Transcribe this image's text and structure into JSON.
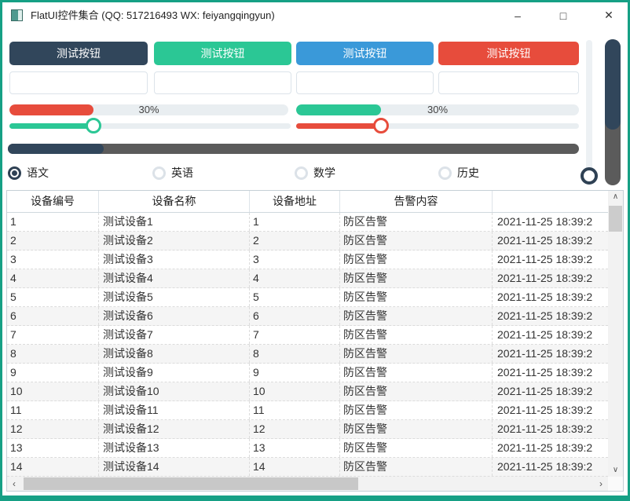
{
  "window": {
    "title": "FlatUI控件集合 (QQ: 517216493 WX: feiyangqingyun)",
    "minimize_glyph": "–",
    "maximize_glyph": "□",
    "close_glyph": "✕"
  },
  "colors": {
    "window_border": "#16A085",
    "dark": "#31465B",
    "green": "#2BC795",
    "blue": "#3A99D9",
    "red": "#E74C3C",
    "light_track": "#E9EEF1",
    "dark_track": "#5B5B5B"
  },
  "buttons": [
    {
      "label": "测试按钮",
      "color": "#31465B"
    },
    {
      "label": "测试按钮",
      "color": "#2BC795"
    },
    {
      "label": "测试按钮",
      "color": "#3A99D9"
    },
    {
      "label": "测试按钮",
      "color": "#E74C3C"
    }
  ],
  "inputs": [
    {
      "value": "",
      "placeholder": ""
    },
    {
      "value": "",
      "placeholder": ""
    },
    {
      "value": "",
      "placeholder": ""
    },
    {
      "value": "",
      "placeholder": ""
    }
  ],
  "progress_bars": [
    {
      "value_percent": 30,
      "label": "30%",
      "fill_color": "#E74C3C"
    },
    {
      "value_percent": 30,
      "label": "30%",
      "fill_color": "#2BC795"
    }
  ],
  "sliders": [
    {
      "value_percent": 30,
      "fill_color": "#2BC795"
    },
    {
      "value_percent": 30,
      "fill_color": "#E74C3C"
    }
  ],
  "scroll_progress_bar": {
    "value_percent": 17,
    "fill_color": "#31465B"
  },
  "vertical_slider": {
    "value_percent": 0
  },
  "vertical_scroll_bar": {
    "value_percent": 62
  },
  "radios": [
    {
      "label": "语文",
      "selected": true
    },
    {
      "label": "英语",
      "selected": false
    },
    {
      "label": "数学",
      "selected": false
    },
    {
      "label": "历史",
      "selected": false
    }
  ],
  "icons": {
    "up": "∧",
    "down": "∨",
    "left": "‹",
    "right": "›"
  },
  "table": {
    "headers": [
      "设备编号",
      "设备名称",
      "设备地址",
      "告警内容",
      ""
    ],
    "rows": [
      [
        "1",
        "测试设备1",
        "1",
        "防区告警",
        "2021-11-25 18:39:2"
      ],
      [
        "2",
        "测试设备2",
        "2",
        "防区告警",
        "2021-11-25 18:39:2"
      ],
      [
        "3",
        "测试设备3",
        "3",
        "防区告警",
        "2021-11-25 18:39:2"
      ],
      [
        "4",
        "测试设备4",
        "4",
        "防区告警",
        "2021-11-25 18:39:2"
      ],
      [
        "5",
        "测试设备5",
        "5",
        "防区告警",
        "2021-11-25 18:39:2"
      ],
      [
        "6",
        "测试设备6",
        "6",
        "防区告警",
        "2021-11-25 18:39:2"
      ],
      [
        "7",
        "测试设备7",
        "7",
        "防区告警",
        "2021-11-25 18:39:2"
      ],
      [
        "8",
        "测试设备8",
        "8",
        "防区告警",
        "2021-11-25 18:39:2"
      ],
      [
        "9",
        "测试设备9",
        "9",
        "防区告警",
        "2021-11-25 18:39:2"
      ],
      [
        "10",
        "测试设备10",
        "10",
        "防区告警",
        "2021-11-25 18:39:2"
      ],
      [
        "11",
        "测试设备11",
        "11",
        "防区告警",
        "2021-11-25 18:39:2"
      ],
      [
        "12",
        "测试设备12",
        "12",
        "防区告警",
        "2021-11-25 18:39:2"
      ],
      [
        "13",
        "测试设备13",
        "13",
        "防区告警",
        "2021-11-25 18:39:2"
      ],
      [
        "14",
        "测试设备14",
        "14",
        "防区告警",
        "2021-11-25 18:39:2"
      ]
    ]
  }
}
